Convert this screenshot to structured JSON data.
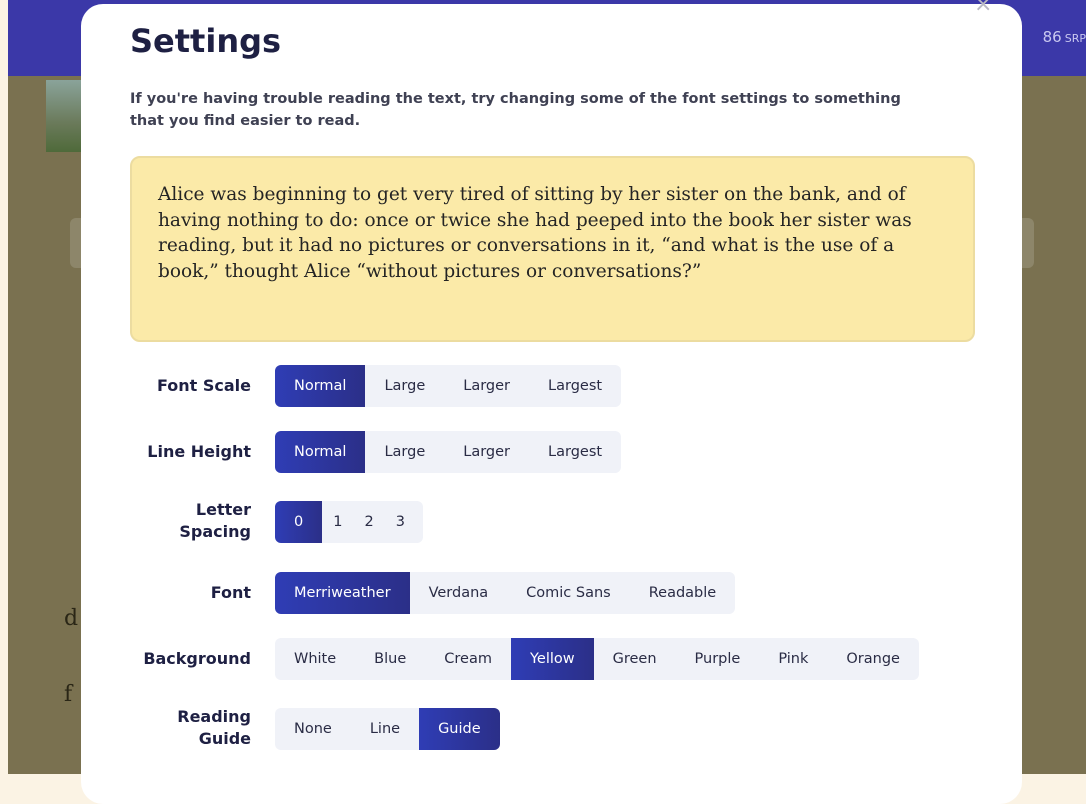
{
  "background_app": {
    "srp_value": "86",
    "srp_unit": "SRP",
    "partial_letters": [
      "d",
      "f"
    ]
  },
  "modal": {
    "title": "Settings",
    "close_symbol": "×",
    "intro": "If you're having trouble reading the text, try changing some of the font settings to something that you find easier to read.",
    "sample_text": "Alice was beginning to get very tired of sitting by her sister on the bank, and of having nothing to do: once or twice she had peeped into the book her sister was reading, but it had no pictures or conversations in it, “and what is the use of a book,” thought Alice “without pictures or conversations?”"
  },
  "settings": {
    "font_scale": {
      "label": "Font Scale",
      "options": [
        "Normal",
        "Large",
        "Larger",
        "Largest"
      ],
      "selected": "Normal"
    },
    "line_height": {
      "label": "Line Height",
      "options": [
        "Normal",
        "Large",
        "Larger",
        "Largest"
      ],
      "selected": "Normal"
    },
    "letter_spacing": {
      "label_line1": "Letter",
      "label_line2": "Spacing",
      "options": [
        "0",
        "1",
        "2",
        "3"
      ],
      "selected": "0"
    },
    "font": {
      "label": "Font",
      "options": [
        "Merriweather",
        "Verdana",
        "Comic Sans",
        "Readable"
      ],
      "selected": "Merriweather"
    },
    "background": {
      "label": "Background",
      "options": [
        "White",
        "Blue",
        "Cream",
        "Yellow",
        "Green",
        "Purple",
        "Pink",
        "Orange"
      ],
      "selected": "Yellow"
    },
    "reading_guide": {
      "label_line1": "Reading",
      "label_line2": "Guide",
      "options": [
        "None",
        "Line",
        "Guide"
      ],
      "selected": "Guide"
    }
  },
  "colors": {
    "accent": "#2f3db5",
    "header": "#3b38a8",
    "sample_bg": "#fbeaa8",
    "overlay": "#7a7150"
  }
}
